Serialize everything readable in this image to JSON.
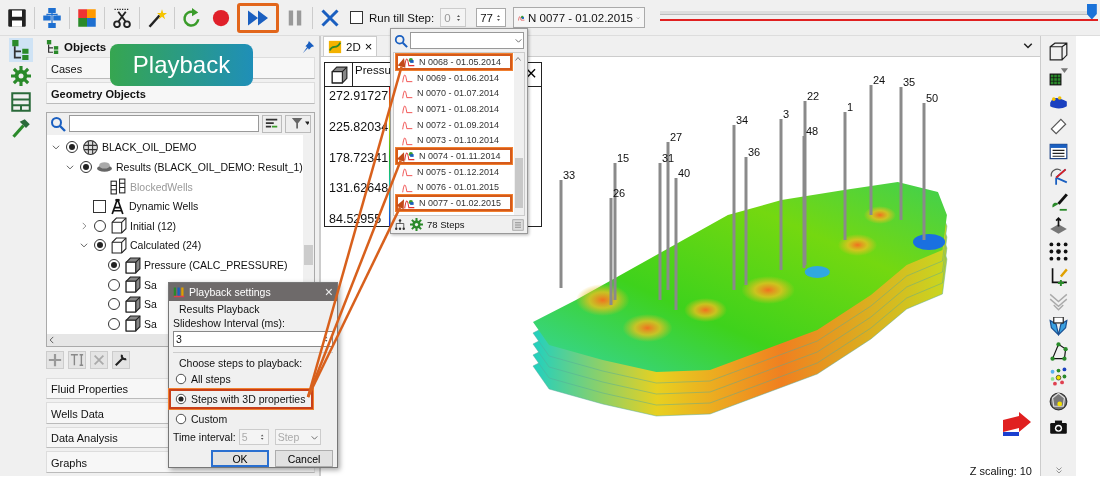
{
  "toolbar": {
    "fast_forward_highlighted": true,
    "run_till_step": {
      "label": "Run till Step:",
      "checked": false
    },
    "step_from": {
      "value": "0",
      "disabled": true
    },
    "step_to": {
      "value": "77",
      "disabled": false
    },
    "step_select": {
      "value": "N 0077 - 01.02.2015"
    },
    "timeline": {
      "level": 0.995
    }
  },
  "callout": {
    "text": "Playback"
  },
  "side_strip": [
    {
      "kind": "tree",
      "selected": true
    },
    {
      "kind": "gear",
      "selected": false
    },
    {
      "kind": "layout",
      "selected": false
    },
    {
      "kind": "hammer",
      "selected": false
    }
  ],
  "objects_panel": {
    "title": "Objects",
    "sections_top": [
      {
        "label": "Cases",
        "selected": false
      },
      {
        "label": "Geometry Objects",
        "selected": true
      }
    ],
    "tree": [
      {
        "kind": "project",
        "label": "BLACK_OIL_DEMO",
        "selected": true,
        "expanded": true,
        "children": [
          {
            "kind": "results",
            "label": "Results (BLACK_OIL_DEMO: Result_1)",
            "selected": true,
            "expanded": true,
            "children": [
              {
                "kind": "wells",
                "label": "BlockedWells",
                "disabled": true
              },
              {
                "kind": "dynamic_wells",
                "label": "Dynamic Wells",
                "checked": false
              },
              {
                "kind": "group",
                "label": "Initial (12)",
                "selected": false,
                "expanded": false
              },
              {
                "kind": "group",
                "label": "Calculated (24)",
                "selected": true,
                "expanded": true,
                "children": [
                  {
                    "kind": "property",
                    "label": "Pressure (CALC_PRESSURE)",
                    "selected": true
                  },
                  {
                    "kind": "property",
                    "label": "Sa",
                    "selected": false
                  },
                  {
                    "kind": "property",
                    "label": "Sa",
                    "selected": false
                  },
                  {
                    "kind": "property",
                    "label": "Sa",
                    "selected": false
                  }
                ]
              }
            ]
          }
        ]
      }
    ],
    "sections_bottom": [
      {
        "label": "Fluid Properties",
        "selected": false
      },
      {
        "label": "Wells Data",
        "selected": false
      },
      {
        "label": "Data Analysis",
        "selected": false
      },
      {
        "label": "Graphs",
        "selected": false
      }
    ]
  },
  "viewport": {
    "tab": {
      "label": "2D",
      "close": "×"
    },
    "legend": {
      "title": "Pressu",
      "close": "×",
      "values": [
        "272.91727",
        "225.82034",
        "178.72341",
        "131.62648",
        "84.52955"
      ]
    },
    "wells": [
      {
        "label": "33"
      },
      {
        "label": "26"
      },
      {
        "label": "15"
      },
      {
        "label": "31"
      },
      {
        "label": "27"
      },
      {
        "label": "40"
      },
      {
        "label": "34"
      },
      {
        "label": "36"
      },
      {
        "label": "3"
      },
      {
        "label": "48"
      },
      {
        "label": "22"
      },
      {
        "label": "1"
      },
      {
        "label": "24"
      },
      {
        "label": "35"
      },
      {
        "label": "50"
      }
    ],
    "status": "Z scaling: 10"
  },
  "step_list": {
    "items": [
      {
        "label": "N 0068 - 01.05.2014",
        "kind": "property",
        "highlighted": true
      },
      {
        "label": "N 0069 - 01.06.2014",
        "kind": "curve",
        "highlighted": false
      },
      {
        "label": "N 0070 - 01.07.2014",
        "kind": "curve",
        "highlighted": false
      },
      {
        "label": "N 0071 - 01.08.2014",
        "kind": "curve",
        "highlighted": false
      },
      {
        "label": "N 0072 - 01.09.2014",
        "kind": "curve",
        "highlighted": false
      },
      {
        "label": "N 0073 - 01.10.2014",
        "kind": "curve",
        "highlighted": false
      },
      {
        "label": "N 0074 - 01.11.2014",
        "kind": "property",
        "highlighted": true
      },
      {
        "label": "N 0075 - 01.12.2014",
        "kind": "curve",
        "highlighted": false
      },
      {
        "label": "N 0076 - 01.01.2015",
        "kind": "curve",
        "highlighted": false
      },
      {
        "label": "N 0077 - 01.02.2015",
        "kind": "property",
        "highlighted": true
      }
    ],
    "footer": "78 Steps"
  },
  "dialog": {
    "title": "Playback settings",
    "close": "×",
    "group_results": "Results Playback",
    "interval_label": "Slideshow Interval (ms):",
    "interval_value": "3",
    "group_steps": "Choose steps to playback:",
    "options": [
      {
        "label": "All steps",
        "selected": false,
        "highlighted": false
      },
      {
        "label": "Steps with 3D properties",
        "selected": true,
        "highlighted": true
      },
      {
        "label": "Custom",
        "selected": false,
        "highlighted": false
      }
    ],
    "time_label": "Time interval:",
    "time_value": {
      "value": "5",
      "disabled": true
    },
    "time_unit": {
      "value": "Step",
      "disabled": true
    },
    "buttons": [
      {
        "label": "OK",
        "default": true
      },
      {
        "label": "Cancel",
        "default": false
      }
    ]
  }
}
